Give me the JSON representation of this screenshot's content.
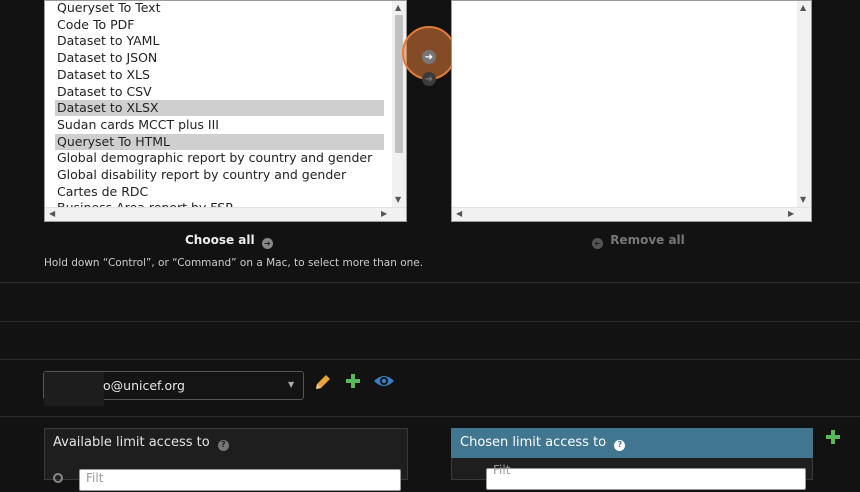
{
  "available_options": [
    {
      "label": "Queryset To Text",
      "selected": false
    },
    {
      "label": "Code To PDF",
      "selected": false
    },
    {
      "label": "Dataset to YAML",
      "selected": false
    },
    {
      "label": "Dataset to JSON",
      "selected": false
    },
    {
      "label": "Dataset to XLS",
      "selected": false
    },
    {
      "label": "Dataset to CSV",
      "selected": false
    },
    {
      "label": "Dataset to XLSX",
      "selected": true
    },
    {
      "label": "Sudan cards MCCT plus III",
      "selected": false
    },
    {
      "label": "Queryset To HTML",
      "selected": true
    },
    {
      "label": "Global demographic report by country and gender",
      "selected": false
    },
    {
      "label": "Global disability report by country and gender",
      "selected": false
    },
    {
      "label": "Cartes de RDC",
      "selected": false
    },
    {
      "label": "Business Area report by FSP",
      "selected": false
    }
  ],
  "controls": {
    "choose_all": "Choose all",
    "remove_all": "Remove all",
    "help_text": "Hold down “Control”, or “Command” on a Mac, to select more than one."
  },
  "owner": {
    "value": "o@unicef.org"
  },
  "limit_access": {
    "available_title": "Available limit access to",
    "chosen_title": "Chosen limit access to",
    "filter_placeholder": "Filt"
  },
  "colors": {
    "chosen_header": "#417690",
    "add_green": "#5cb85c",
    "edit_orange": "#e8a33d",
    "view_blue": "#3a7ec1",
    "highlight": "#e07b39"
  },
  "icons": {
    "choose_all": "arrow-right-circle-icon",
    "remove_all": "arrow-left-circle-icon",
    "edit": "pencil-icon",
    "add": "plus-icon",
    "view": "eye-icon",
    "help": "question-circle-icon",
    "search": "search-icon"
  }
}
